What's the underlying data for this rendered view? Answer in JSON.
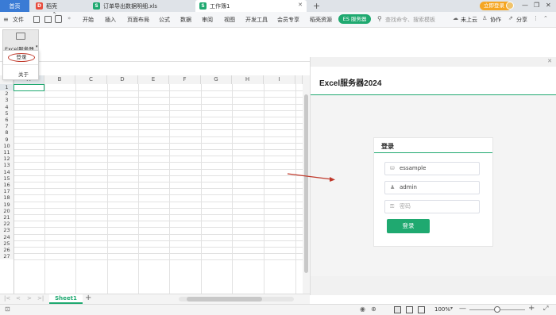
{
  "tabs": {
    "home": "首页",
    "daoke": "稻壳",
    "file1": "订单导出数据明细.xls",
    "file2": "工作簿1",
    "new_tab": "+"
  },
  "window": {
    "login_btn": "立即登录",
    "min": "—",
    "restore": "❐",
    "close": "✕"
  },
  "menu": {
    "file": "文件",
    "items": [
      "开始",
      "插入",
      "页面布局",
      "公式",
      "数据",
      "审阅",
      "视图",
      "开发工具",
      "会员专享",
      "稻壳资源"
    ],
    "es_badge": "ES 服务器",
    "search_placeholder": "查找命令、搜索模板",
    "cloud": "未上云",
    "collab": "协作",
    "share": "分享"
  },
  "excel_server": {
    "group_label": "Excel服务器",
    "dropdown_login": "登录",
    "dropdown_about": "关于"
  },
  "formula_bar": {
    "fx": "fx",
    "cell_ref": ""
  },
  "grid": {
    "columns": [
      "A",
      "B",
      "C",
      "D",
      "E",
      "F",
      "G",
      "H",
      "I"
    ],
    "rows": [
      "1",
      "2",
      "3",
      "4",
      "5",
      "6",
      "7",
      "8",
      "9",
      "10",
      "11",
      "12",
      "13",
      "14",
      "15",
      "16",
      "17",
      "18",
      "19",
      "20",
      "21",
      "22",
      "23",
      "24",
      "25",
      "26",
      "27"
    ]
  },
  "sheet_tabs": {
    "active": "Sheet1",
    "add": "+"
  },
  "side_panel": {
    "title": "Excel服务器2024",
    "login_card": {
      "title": "登录",
      "server_value": "essample",
      "user_value": "admin",
      "password_placeholder": "密码",
      "submit_label": "登录"
    }
  },
  "status": {
    "zoom": "100%"
  },
  "colors": {
    "accent_green": "#1fa970",
    "es_green": "#1fa970",
    "annotation_red": "#c0392b"
  }
}
